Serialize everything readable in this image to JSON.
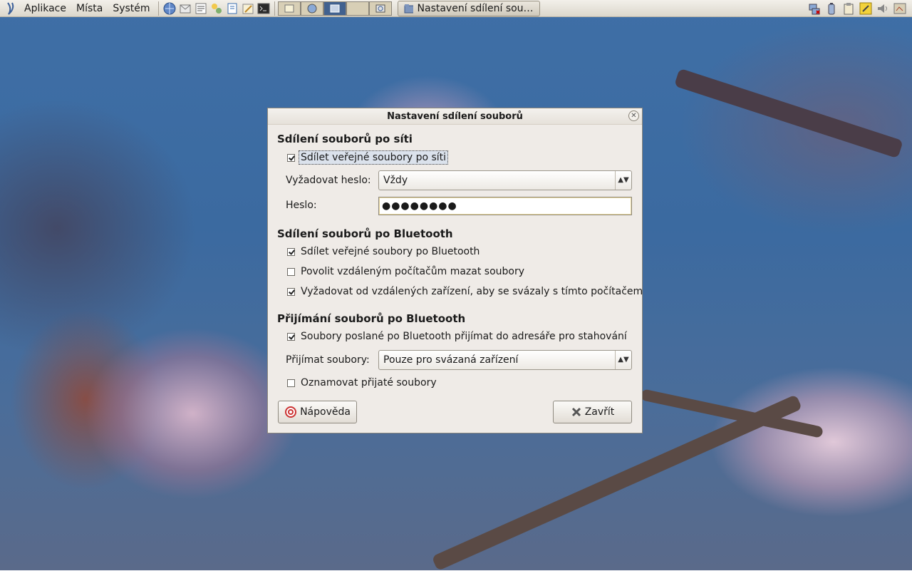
{
  "panel": {
    "menus": [
      "Aplikace",
      "Místa",
      "Systém"
    ],
    "task_label": "Nastavení sdílení sou…"
  },
  "dialog": {
    "title": "Nastavení sdílení souborů",
    "network_section": {
      "title": "Sdílení souborů po síti",
      "share_public": {
        "label": "Sdílet veřejné soubory po síti",
        "checked": true
      },
      "require_password_label": "Vyžadovat heslo:",
      "require_password_value": "Vždy",
      "password_label": "Heslo:",
      "password_value": "●●●●●●●●"
    },
    "bluetooth_section": {
      "title": "Sdílení souborů po Bluetooth",
      "share_public": {
        "label": "Sdílet veřejné soubory po Bluetooth",
        "checked": true
      },
      "allow_delete": {
        "label": "Povolit vzdáleným počítačům mazat soubory",
        "checked": false
      },
      "require_pairing": {
        "label": "Vyžadovat od vzdálených zařízení, aby se svázaly s tímto počítačem",
        "checked": true
      }
    },
    "receive_section": {
      "title": "Přijímání souborů po Bluetooth",
      "receive_to_downloads": {
        "label": "Soubory poslané po Bluetooth přijímat do adresáře pro stahování",
        "checked": true
      },
      "accept_files_label": "Přijímat soubory:",
      "accept_files_value": "Pouze pro svázaná zařízení",
      "notify": {
        "label": "Oznamovat přijaté soubory",
        "checked": false
      }
    },
    "help_button": "Nápověda",
    "close_button": "Zavřít"
  }
}
